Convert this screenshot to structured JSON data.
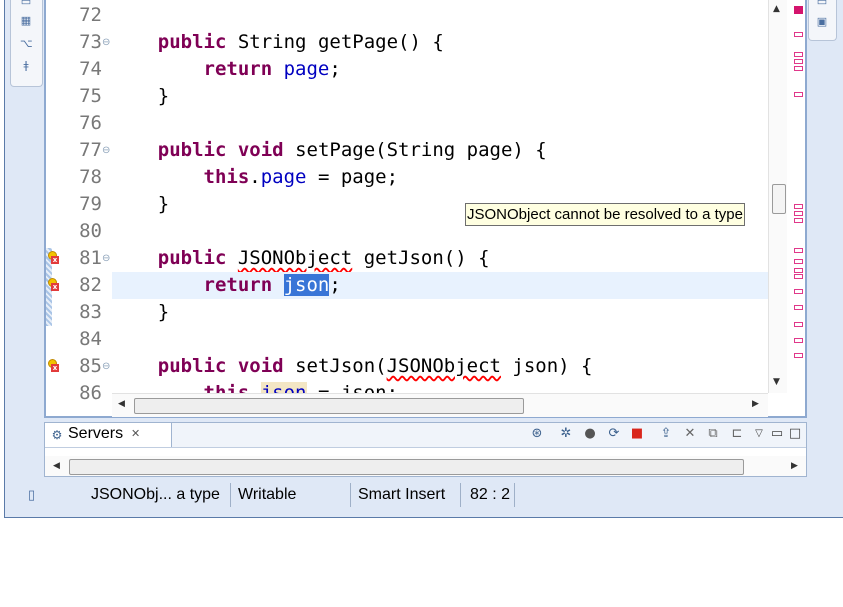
{
  "editor": {
    "lines": [
      {
        "num": "72",
        "fold": "",
        "text": ""
      },
      {
        "num": "73",
        "fold": "⊖",
        "text": "public String getPage() {"
      },
      {
        "num": "74",
        "fold": "",
        "text": "return page;"
      },
      {
        "num": "75",
        "fold": "",
        "text": "}"
      },
      {
        "num": "76",
        "fold": "",
        "text": ""
      },
      {
        "num": "77",
        "fold": "⊖",
        "text": "public void setPage(String page) {"
      },
      {
        "num": "78",
        "fold": "",
        "text": "this.page = page;"
      },
      {
        "num": "79",
        "fold": "",
        "text": "}"
      },
      {
        "num": "80",
        "fold": "",
        "text": ""
      },
      {
        "num": "81",
        "fold": "⊖",
        "text": "public JSONObject getJson() {"
      },
      {
        "num": "82",
        "fold": "",
        "text": "return json;"
      },
      {
        "num": "83",
        "fold": "",
        "text": "}"
      },
      {
        "num": "84",
        "fold": "",
        "text": ""
      },
      {
        "num": "85",
        "fold": "⊖",
        "text": "public void setJson(JSONObject json) {"
      },
      {
        "num": "86",
        "fold": "",
        "text": "this.json = json;"
      }
    ],
    "tokens": {
      "public": "public",
      "String": "String",
      "getPage": "getPage() {",
      "return": "return",
      "page": "page",
      "semi": ";",
      "brace": "}",
      "void": "void",
      "setPage": "setPage(String page) {",
      "this": "this",
      "dot": ".",
      "assign_page": " = page;",
      "JSONObject": "JSONObject",
      "getJson": "getJson() {",
      "json": "json",
      "setJson_open": "setJson(",
      "setJson_close": " json) {",
      "assign_json": " = json;"
    },
    "tooltip": "JSONObject cannot be resolved to a type"
  },
  "servers": {
    "tab_label": "Servers",
    "close_icon": "✕"
  },
  "status": {
    "message": "JSONObj... a type",
    "writable": "Writable",
    "insert_mode": "Smart Insert",
    "position": "82 : 2"
  },
  "colors": {
    "keyword": "#7f0055",
    "field": "#0000c0",
    "selection": "#3875d7",
    "current_line": "#e8f2fe",
    "error_marker": "#d4146d"
  }
}
